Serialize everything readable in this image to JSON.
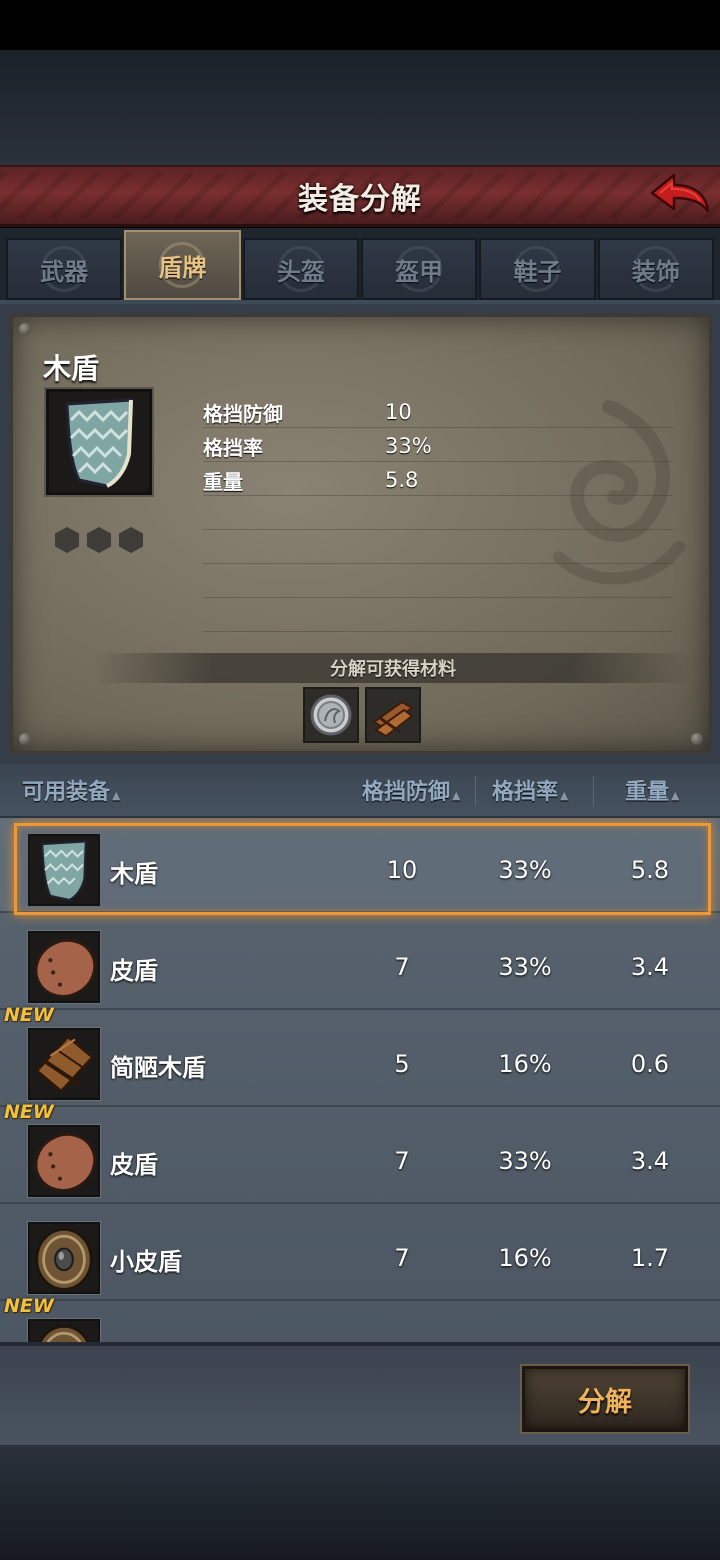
{
  "header": {
    "title": "装备分解"
  },
  "tabs": [
    {
      "label": "武器",
      "active": false
    },
    {
      "label": "盾牌",
      "active": true
    },
    {
      "label": "头盔",
      "active": false
    },
    {
      "label": "盔甲",
      "active": false
    },
    {
      "label": "鞋子",
      "active": false
    },
    {
      "label": "装饰",
      "active": false
    }
  ],
  "selected_item": {
    "name": "木盾",
    "icon": "wooden-shield-icon",
    "stats": [
      {
        "label": "格挡防御",
        "value": "10"
      },
      {
        "label": "格挡率",
        "value": "33%"
      },
      {
        "label": "重量",
        "value": "5.8"
      }
    ],
    "gem_slots": 3,
    "materials_label": "分解可获得材料",
    "materials": [
      "silver-coin-icon",
      "wood-planks-icon"
    ]
  },
  "list_header": {
    "name": "可用装备",
    "block_defense": "格挡防御",
    "block_rate": "格挡率",
    "weight": "重量"
  },
  "items": [
    {
      "name": "木盾",
      "icon": "wooden-shield-icon",
      "defense": "10",
      "rate": "33%",
      "weight": "5.8",
      "new": false,
      "selected": true
    },
    {
      "name": "皮盾",
      "icon": "leather-shield-icon",
      "defense": "7",
      "rate": "33%",
      "weight": "3.4",
      "new": false,
      "selected": false
    },
    {
      "name": "简陋木盾",
      "icon": "crude-wooden-shield-icon",
      "defense": "5",
      "rate": "16%",
      "weight": "0.6",
      "new": true,
      "new_label": "NEW",
      "selected": false
    },
    {
      "name": "皮盾",
      "icon": "leather-shield-icon",
      "defense": "7",
      "rate": "33%",
      "weight": "3.4",
      "new": true,
      "new_label": "NEW",
      "selected": false
    },
    {
      "name": "小皮盾",
      "icon": "small-leather-shield-icon",
      "defense": "7",
      "rate": "16%",
      "weight": "1.7",
      "new": false,
      "selected": false
    },
    {
      "name": "",
      "icon": "small-leather-shield-icon",
      "defense": "",
      "rate": "",
      "weight": "",
      "new": true,
      "new_label": "NEW",
      "selected": false
    }
  ],
  "actions": {
    "decompose_label": "分解"
  },
  "colors": {
    "accent": "#e89a3a",
    "title_bar": "#7a2f30",
    "tab_active_text": "#e9c384",
    "button_text": "#f0b35a"
  }
}
